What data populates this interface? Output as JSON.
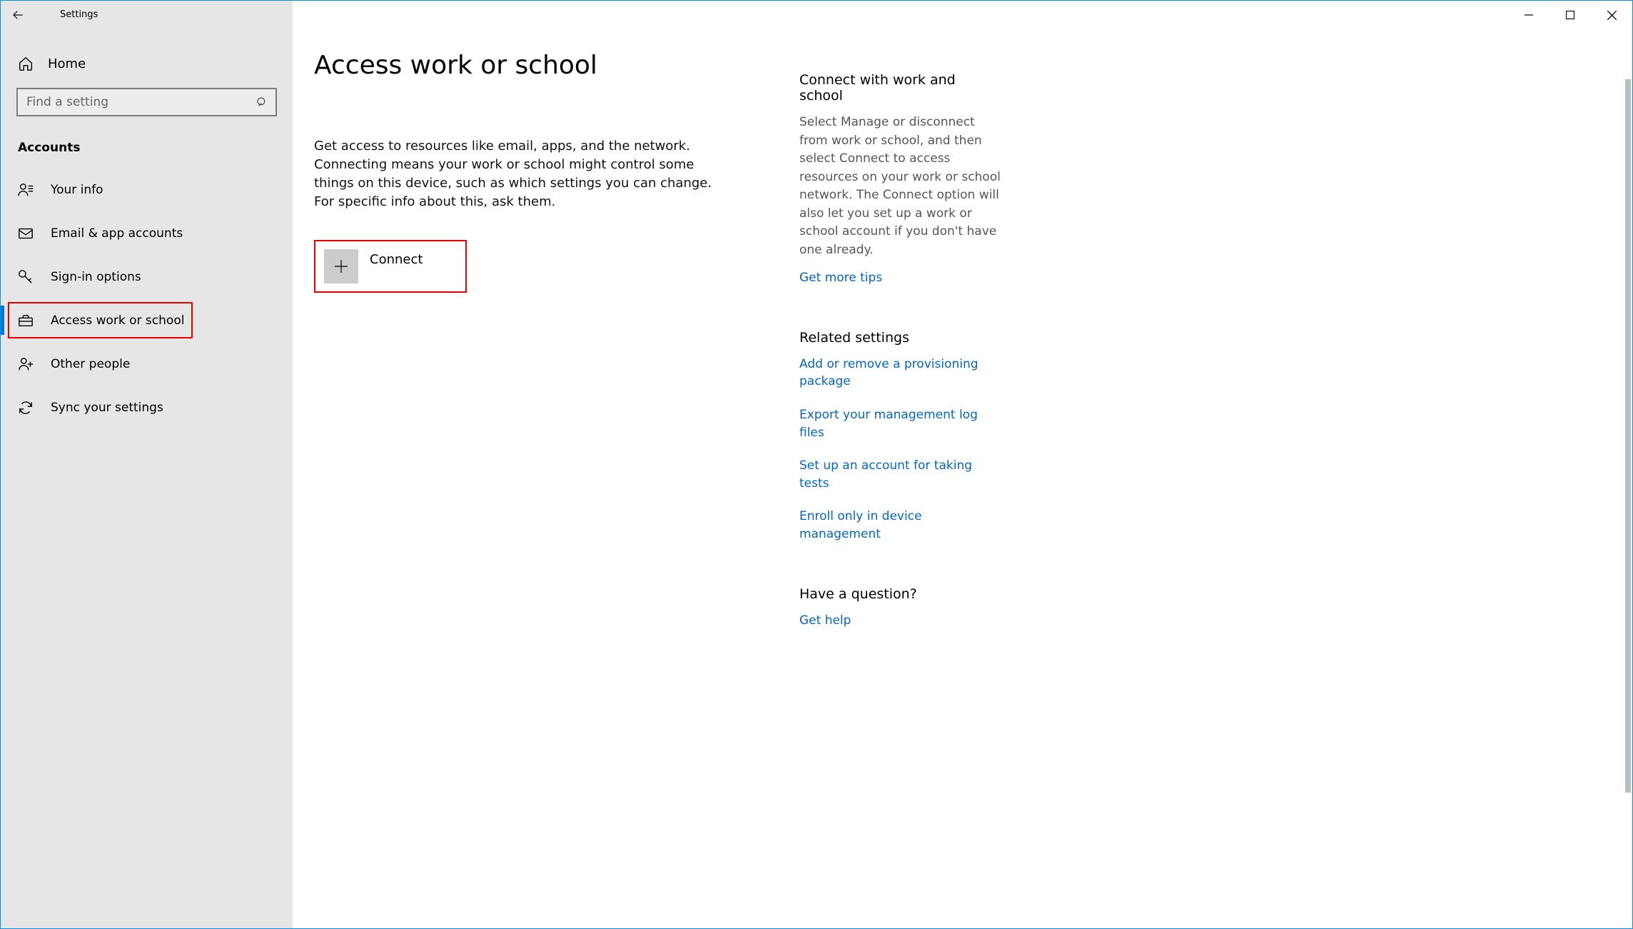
{
  "titlebar": {
    "app_name": "Settings"
  },
  "sidebar": {
    "home_label": "Home",
    "search_placeholder": "Find a setting",
    "section_label": "Accounts",
    "items": [
      {
        "label": "Your info"
      },
      {
        "label": "Email & app accounts"
      },
      {
        "label": "Sign-in options"
      },
      {
        "label": "Access work or school"
      },
      {
        "label": "Other people"
      },
      {
        "label": "Sync your settings"
      }
    ]
  },
  "main": {
    "title": "Access work or school",
    "description": "Get access to resources like email, apps, and the network. Connecting means your work or school might control some things on this device, such as which settings you can change. For specific info about this, ask them.",
    "connect_label": "Connect"
  },
  "right": {
    "section1_title": "Connect with work and school",
    "section1_body": "Select Manage or disconnect from work or school, and then select Connect to access resources on your work or school network. The Connect option will also let you set up a work or school account if you don't have one already.",
    "section1_link": "Get more tips",
    "section2_title": "Related settings",
    "section2_links": [
      "Add or remove a provisioning package",
      "Export your management log files",
      "Set up an account for taking tests",
      "Enroll only in device management"
    ],
    "section3_title": "Have a question?",
    "section3_link": "Get help"
  }
}
